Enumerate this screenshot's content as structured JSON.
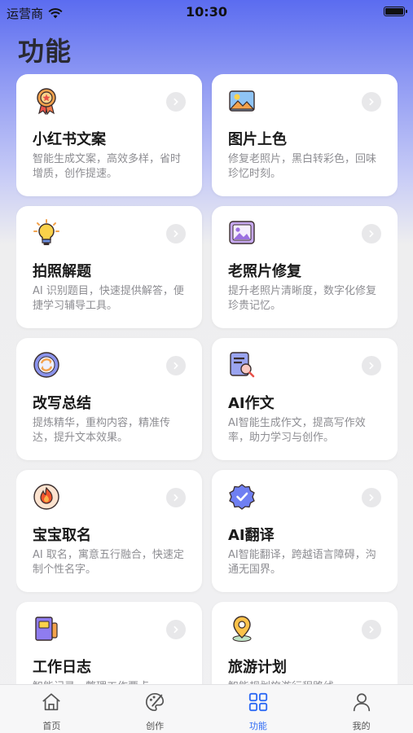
{
  "status": {
    "carrier": "运营商",
    "time": "10:30"
  },
  "page": {
    "title": "功能"
  },
  "cards": [
    {
      "name": "小红书文案",
      "desc": "智能生成文案，高效多样，省时增质，创作提速。",
      "icon": "award-badge-icon"
    },
    {
      "name": "图片上色",
      "desc": "修复老照片，黑白转彩色，回味珍忆时刻。",
      "icon": "landscape-image-icon"
    },
    {
      "name": "拍照解题",
      "desc": "AI 识别题目，快速提供解答，便捷学习辅导工具。",
      "icon": "lightbulb-icon"
    },
    {
      "name": "老照片修复",
      "desc": "提升老照片清晰度，数字化修复珍贵记忆。",
      "icon": "photo-frame-icon"
    },
    {
      "name": "改写总结",
      "desc": "提炼精华，重构内容，精准传达，提升文本效果。",
      "icon": "refresh-circle-icon"
    },
    {
      "name": "AI作文",
      "desc": "AI智能生成作文，提高写作效率，助力学习与创作。",
      "icon": "document-search-icon"
    },
    {
      "name": "宝宝取名",
      "desc": "AI 取名，寓意五行融合，快速定制个性名字。",
      "icon": "flame-icon"
    },
    {
      "name": "AI翻译",
      "desc": "AI智能翻译，跨越语言障碍，沟通无国界。",
      "icon": "verified-badge-icon"
    },
    {
      "name": "工作日志",
      "desc": "智能记录，整理工作要点。",
      "icon": "notebook-icon"
    },
    {
      "name": "旅游计划",
      "desc": "智能规划旅游行程路线。",
      "icon": "location-pin-icon"
    }
  ],
  "tabs": [
    {
      "label": "首页",
      "icon": "home-icon",
      "active": false
    },
    {
      "label": "创作",
      "icon": "palette-icon",
      "active": false
    },
    {
      "label": "功能",
      "icon": "grid-icon",
      "active": true
    },
    {
      "label": "我的",
      "icon": "user-icon",
      "active": false
    }
  ],
  "colors": {
    "accent": "#2f6bf4",
    "header_gradient_top": "#5b6cf0",
    "background": "#f1f1f3"
  }
}
